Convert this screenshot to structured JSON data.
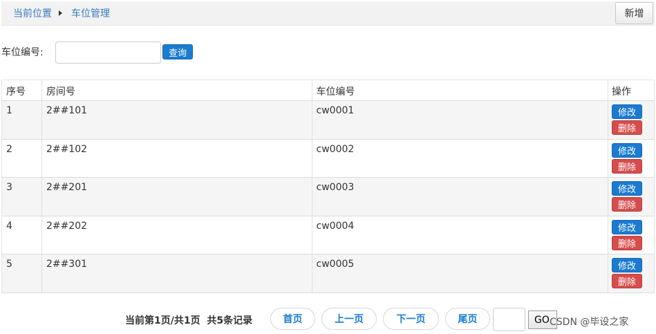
{
  "breadcrumb": {
    "current_location": "当前位置",
    "page": "车位管理"
  },
  "toolbar": {
    "add_label": "新增"
  },
  "search": {
    "label": "车位编号:",
    "value": "",
    "button_label": "查询"
  },
  "table": {
    "headers": [
      "序号",
      "房间号",
      "车位编号",
      "操作"
    ],
    "rows": [
      {
        "index": "1",
        "room": "2##101",
        "space": "cw0001"
      },
      {
        "index": "2",
        "room": "2##102",
        "space": "cw0002"
      },
      {
        "index": "3",
        "room": "2##201",
        "space": "cw0003"
      },
      {
        "index": "4",
        "room": "2##202",
        "space": "cw0004"
      },
      {
        "index": "5",
        "room": "2##301",
        "space": "cw0005"
      }
    ],
    "edit_label": "修改",
    "delete_label": "删除"
  },
  "pagination": {
    "info": "当前第1页/共1页  共5条记录",
    "first": "首页",
    "prev": "上一页",
    "next": "下一页",
    "last": "尾页",
    "go": "GO",
    "page_value": ""
  },
  "watermark": "CSDN @毕设之家",
  "colors": {
    "primary": "#1a7bd1",
    "danger": "#d64d4d",
    "link": "#3a7bbf"
  }
}
